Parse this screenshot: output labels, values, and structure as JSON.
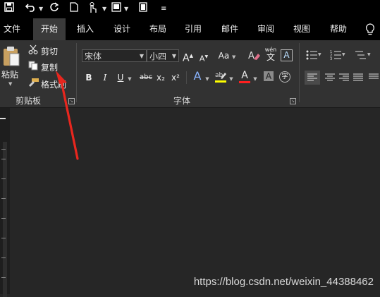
{
  "colors": {
    "highlight_yellow": "#ffff00",
    "font_red": "#ff2020",
    "annotation_arrow": "#e8261e"
  },
  "tabs": [
    {
      "label": "文件"
    },
    {
      "label": "开始"
    },
    {
      "label": "插入"
    },
    {
      "label": "设计"
    },
    {
      "label": "布局"
    },
    {
      "label": "引用"
    },
    {
      "label": "邮件"
    },
    {
      "label": "审阅"
    },
    {
      "label": "视图"
    },
    {
      "label": "帮助"
    }
  ],
  "clipboard": {
    "paste_label": "粘贴",
    "cut_label": "剪切",
    "copy_label": "复制",
    "format_painter_label": "格式刷",
    "group_label": "剪贴板"
  },
  "font": {
    "font_name": "宋体",
    "font_size": "小四",
    "group_label": "字体",
    "change_case_label": "Aa",
    "phonetic_label": "wén",
    "phonetic_char": "文",
    "border_char": "A",
    "bold": "B",
    "italic": "I",
    "underline": "U",
    "strike": "abc",
    "subscript": "x₂",
    "superscript": "x²",
    "text_effect": "A",
    "font_color": "A",
    "char_shading": "A",
    "enclose": "字",
    "grow": "A",
    "shrink": "A"
  },
  "watermark": "https://blog.csdn.net/weixin_44388462"
}
